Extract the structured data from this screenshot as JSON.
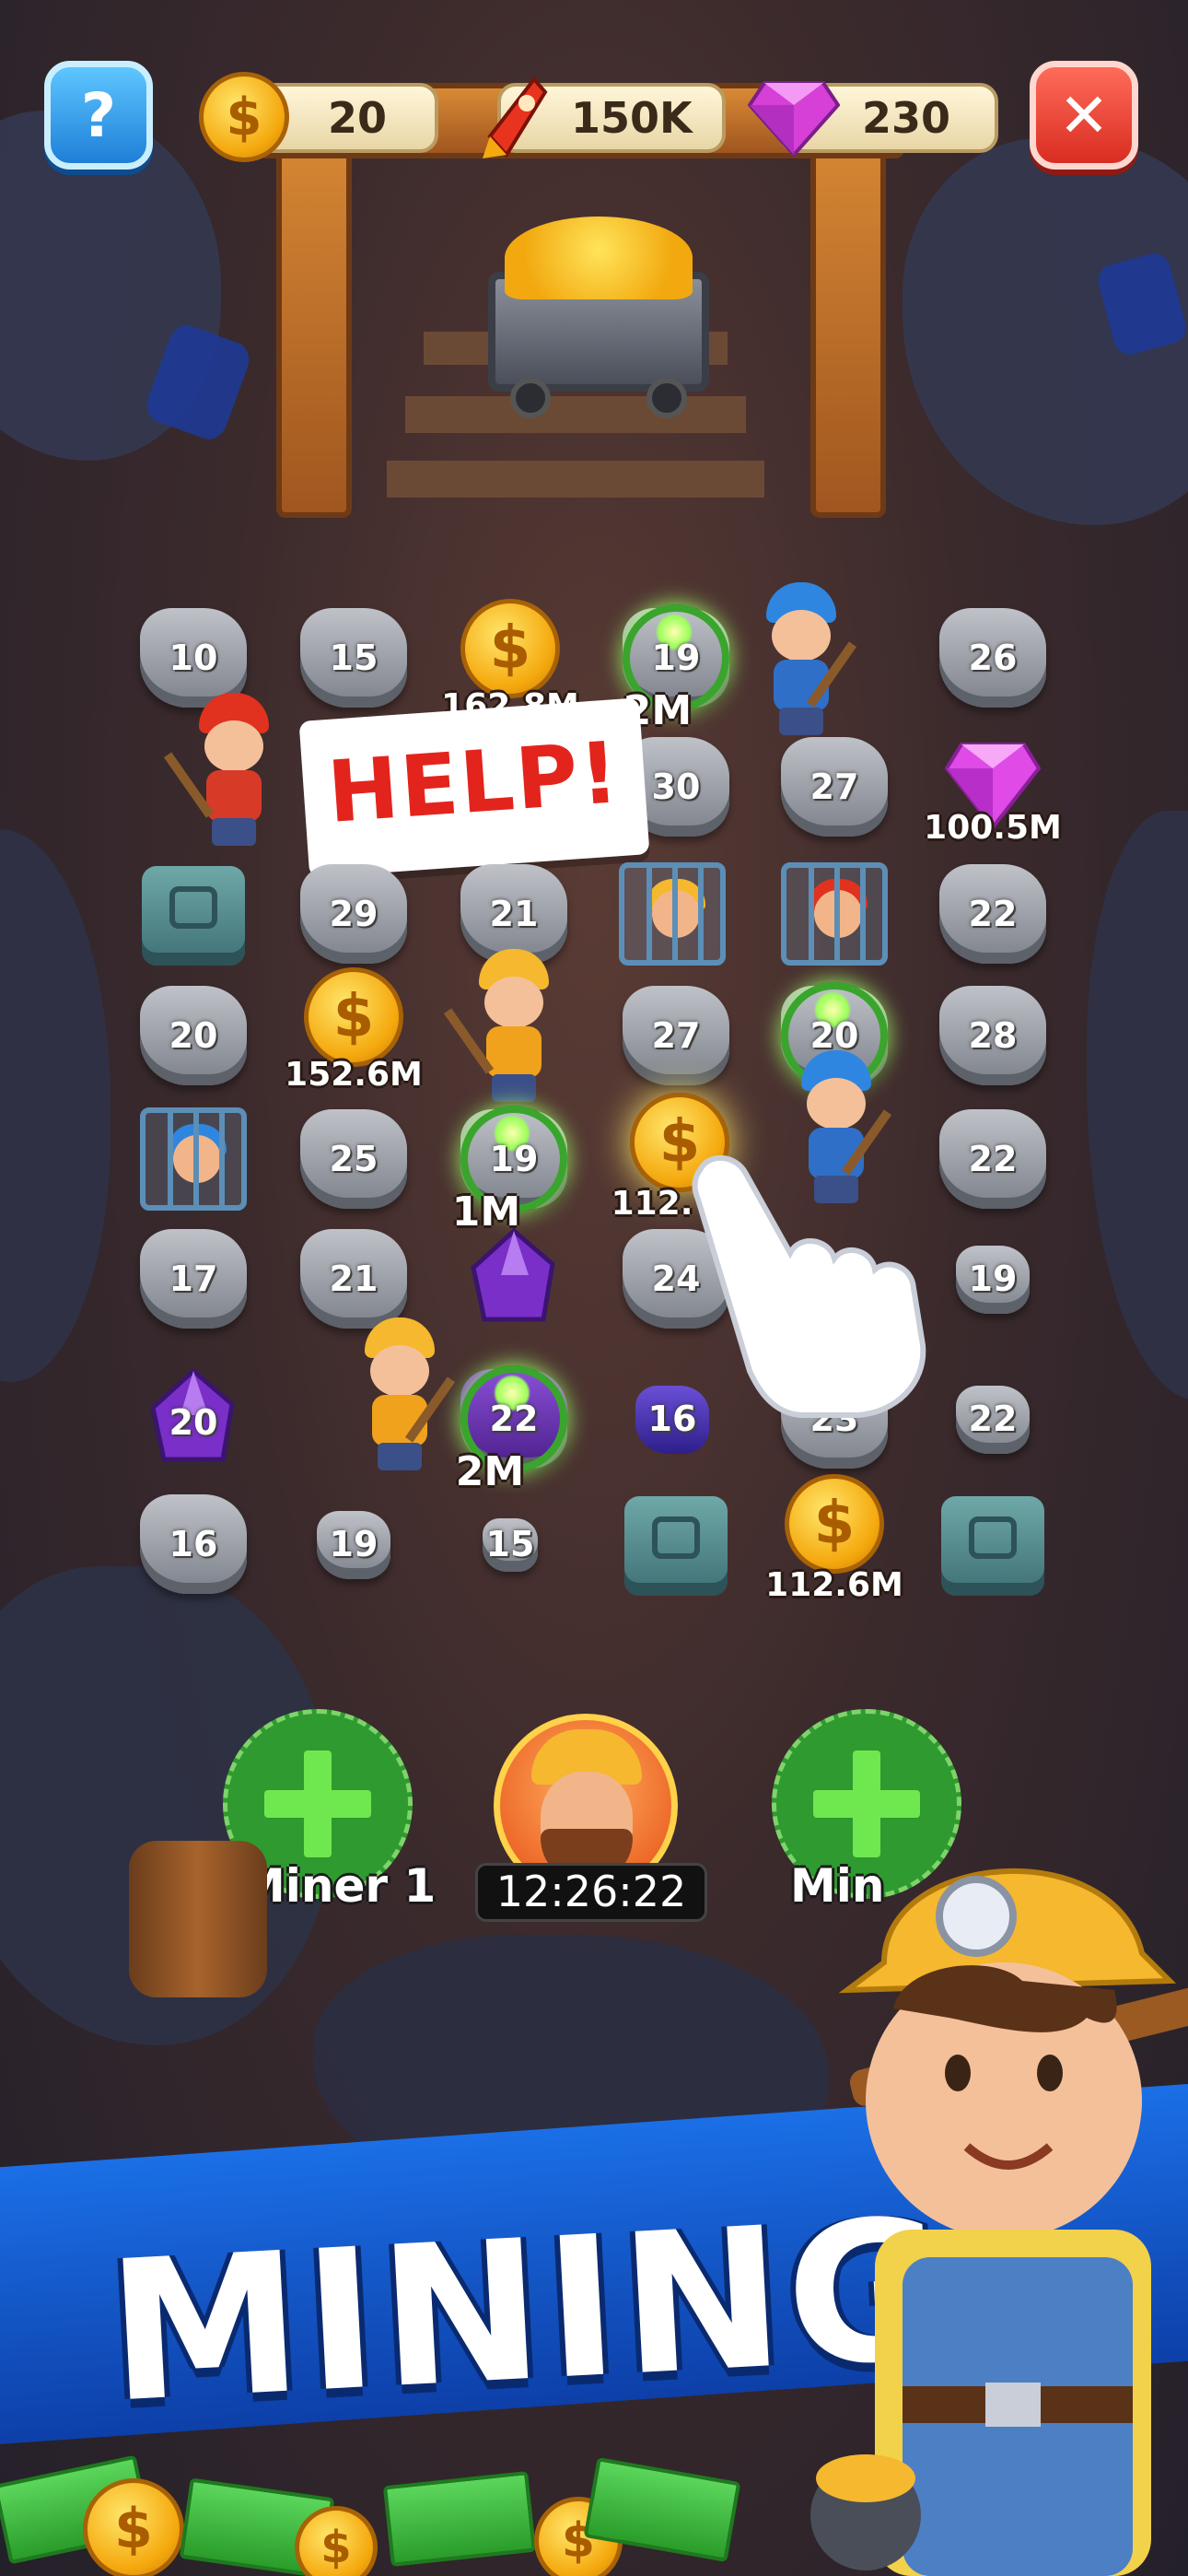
{
  "hud": {
    "help_icon": "question-icon",
    "coins": {
      "icon": "coin-icon",
      "value": "20"
    },
    "rockets": {
      "icon": "rocket-icon",
      "value": "150K"
    },
    "gems": {
      "icon": "gem-icon",
      "value": "230"
    },
    "close_icon": "close-icon"
  },
  "grid": {
    "rocks": [
      {
        "label": "10"
      },
      {
        "label": "15"
      },
      {
        "label": "19"
      },
      {
        "label": "26"
      },
      {
        "label": "30"
      },
      {
        "label": "27"
      },
      {
        "label": "29"
      },
      {
        "label": "21"
      },
      {
        "label": "22"
      },
      {
        "label": "20"
      },
      {
        "label": "27"
      },
      {
        "label": "20"
      },
      {
        "label": "28"
      },
      {
        "label": "25"
      },
      {
        "label": "19"
      },
      {
        "label": "22"
      },
      {
        "label": "17"
      },
      {
        "label": "21"
      },
      {
        "label": "24"
      },
      {
        "label": "19"
      },
      {
        "label": "20"
      },
      {
        "label": "22"
      },
      {
        "label": "16"
      },
      {
        "label": "23"
      },
      {
        "label": "22"
      },
      {
        "label": "16"
      },
      {
        "label": "19"
      },
      {
        "label": "15"
      }
    ],
    "rewards": [
      {
        "label": "162.8M"
      },
      {
        "label": "2M"
      },
      {
        "label": "100.5M"
      },
      {
        "label": "152.6M"
      },
      {
        "label": "1M"
      },
      {
        "label": "112."
      },
      {
        "label": "2M"
      },
      {
        "label": "112.6M"
      }
    ]
  },
  "help_bubble": {
    "text": "HELP!"
  },
  "miner_slots": [
    {
      "label": "Miner 1",
      "icon": "plus-icon"
    },
    {
      "timer": "12:26:22",
      "icon": "miner-portrait"
    },
    {
      "label": "Min",
      "icon": "plus-icon"
    }
  ],
  "banner": {
    "title": "MINING"
  },
  "colors": {
    "accent_blue": "#1b6fe6",
    "gold": "#f5a90e",
    "help_red": "#e3241c",
    "slot_green": "#2f9a2f"
  }
}
